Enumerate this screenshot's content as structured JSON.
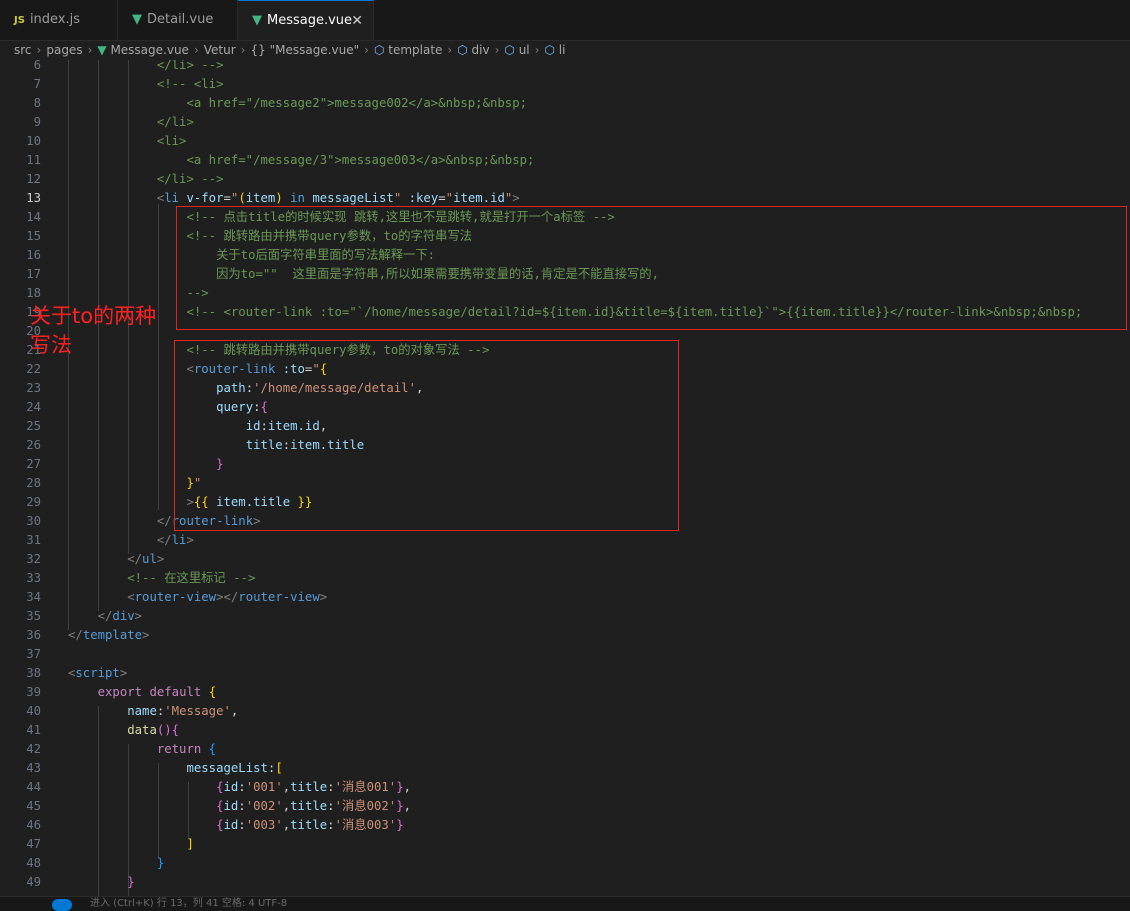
{
  "tabs": [
    {
      "label": "index.js",
      "icon": "JS"
    },
    {
      "label": "Detail.vue",
      "icon": "V"
    },
    {
      "label": "Message.vue",
      "icon": "V",
      "active": true
    }
  ],
  "breadcrumb": {
    "src": "src",
    "pages": "pages",
    "file": "Message.vue",
    "vetur": "Vetur",
    "braces": "{}",
    "module": "\"Message.vue\"",
    "template": "template",
    "div": "div",
    "ul": "ul",
    "li": "li"
  },
  "annotation": {
    "line1": "关于to的两种",
    "line2": "写法"
  },
  "statusbar": {
    "text": "进入 (Ctrl+K)   行 13，列 41   空格: 4   UTF-8"
  },
  "colors": {
    "annotation_red": "#e02424",
    "accent": "#0078d4",
    "vue_green": "#41b883"
  },
  "editor": {
    "current_line": 13,
    "lines": [
      {
        "n": 6,
        "tokens": [
          {
            "c": "t-cm",
            "v": "            </li> -->"
          }
        ]
      },
      {
        "n": 7,
        "tokens": [
          {
            "c": "t-cm",
            "v": "            <!-- <li>"
          }
        ]
      },
      {
        "n": 8,
        "tokens": [
          {
            "c": "t-cm",
            "v": "                <a href=\"/message2\">message002</a>&nbsp;&nbsp;"
          }
        ]
      },
      {
        "n": 9,
        "tokens": [
          {
            "c": "t-cm",
            "v": "            </li>"
          }
        ]
      },
      {
        "n": 10,
        "tokens": [
          {
            "c": "t-cm",
            "v": "            <li>"
          }
        ]
      },
      {
        "n": 11,
        "tokens": [
          {
            "c": "t-cm",
            "v": "                <a href=\"/message/3\">message003</a>&nbsp;&nbsp;"
          }
        ]
      },
      {
        "n": 12,
        "tokens": [
          {
            "c": "t-cm",
            "v": "            </li> -->"
          }
        ]
      },
      {
        "n": 13,
        "tokens": [
          {
            "c": "t-brk",
            "v": "            <"
          },
          {
            "c": "t-tag",
            "v": "li"
          },
          {
            "c": "t-txt",
            "v": " "
          },
          {
            "c": "t-attr",
            "v": "v-for"
          },
          {
            "c": "t-txt",
            "v": "="
          },
          {
            "c": "t-str",
            "v": "\""
          },
          {
            "c": "t-b1",
            "v": "("
          },
          {
            "c": "t-var",
            "v": "item"
          },
          {
            "c": "t-b1",
            "v": ")"
          },
          {
            "c": "t-txt",
            "v": " "
          },
          {
            "c": "t-kb",
            "v": "in"
          },
          {
            "c": "t-txt",
            "v": " "
          },
          {
            "c": "t-var",
            "v": "messageList"
          },
          {
            "c": "t-str",
            "v": "\""
          },
          {
            "c": "t-txt",
            "v": " "
          },
          {
            "c": "t-attr",
            "v": ":key"
          },
          {
            "c": "t-txt",
            "v": "="
          },
          {
            "c": "t-str",
            "v": "\""
          },
          {
            "c": "t-var",
            "v": "item.id"
          },
          {
            "c": "t-str",
            "v": "\""
          },
          {
            "c": "t-brk",
            "v": ">"
          }
        ]
      },
      {
        "n": 14,
        "tokens": [
          {
            "c": "t-cm",
            "v": "                <!-- 点击title的时候实现 跳转,这里也不是跳转,就是打开一个a标签 -->"
          }
        ]
      },
      {
        "n": 15,
        "tokens": [
          {
            "c": "t-cm",
            "v": "                <!-- 跳转路由并携带query参数，to的字符串写法"
          }
        ]
      },
      {
        "n": 16,
        "tokens": [
          {
            "c": "t-cm",
            "v": "                    关于to后面字符串里面的写法解释一下:"
          }
        ]
      },
      {
        "n": 17,
        "tokens": [
          {
            "c": "t-cm",
            "v": "                    因为to=\"\"  这里面是字符串,所以如果需要携带变量的话,肯定是不能直接写的,"
          }
        ]
      },
      {
        "n": 18,
        "tokens": [
          {
            "c": "t-cm",
            "v": "                -->"
          }
        ]
      },
      {
        "n": 19,
        "tokens": [
          {
            "c": "t-cm",
            "v": "                <!-- <router-link :to=\"`/home/message/detail?id=${item.id}&title=${item.title}`\">{{item.title}}</router-link>&nbsp;&nbsp;"
          }
        ]
      },
      {
        "n": 20,
        "tokens": []
      },
      {
        "n": 21,
        "tokens": [
          {
            "c": "t-cm",
            "v": "                <!-- 跳转路由并携带query参数，to的对象写法 -->"
          }
        ]
      },
      {
        "n": 22,
        "tokens": [
          {
            "c": "t-brk",
            "v": "                <"
          },
          {
            "c": "t-tag",
            "v": "router-link"
          },
          {
            "c": "t-txt",
            "v": " "
          },
          {
            "c": "t-attr",
            "v": ":to"
          },
          {
            "c": "t-txt",
            "v": "="
          },
          {
            "c": "t-str",
            "v": "\""
          },
          {
            "c": "t-b1",
            "v": "{"
          }
        ]
      },
      {
        "n": 23,
        "tokens": [
          {
            "c": "t-txt",
            "v": "                    "
          },
          {
            "c": "t-var",
            "v": "path"
          },
          {
            "c": "t-txt",
            "v": ":"
          },
          {
            "c": "t-str",
            "v": "'/home/message/detail'"
          },
          {
            "c": "t-txt",
            "v": ","
          }
        ]
      },
      {
        "n": 24,
        "tokens": [
          {
            "c": "t-txt",
            "v": "                    "
          },
          {
            "c": "t-var",
            "v": "query"
          },
          {
            "c": "t-txt",
            "v": ":"
          },
          {
            "c": "t-b2",
            "v": "{"
          }
        ]
      },
      {
        "n": 25,
        "tokens": [
          {
            "c": "t-txt",
            "v": "                        "
          },
          {
            "c": "t-var",
            "v": "id"
          },
          {
            "c": "t-txt",
            "v": ":"
          },
          {
            "c": "t-var",
            "v": "item.id"
          },
          {
            "c": "t-txt",
            "v": ","
          }
        ]
      },
      {
        "n": 26,
        "tokens": [
          {
            "c": "t-txt",
            "v": "                        "
          },
          {
            "c": "t-var",
            "v": "title"
          },
          {
            "c": "t-txt",
            "v": ":"
          },
          {
            "c": "t-var",
            "v": "item.title"
          }
        ]
      },
      {
        "n": 27,
        "tokens": [
          {
            "c": "t-b2",
            "v": "                    }"
          }
        ]
      },
      {
        "n": 28,
        "tokens": [
          {
            "c": "t-b1",
            "v": "                }"
          },
          {
            "c": "t-str",
            "v": "\""
          }
        ]
      },
      {
        "n": 29,
        "tokens": [
          {
            "c": "t-brk",
            "v": "                >"
          },
          {
            "c": "t-b1",
            "v": "{{"
          },
          {
            "c": "t-txt",
            "v": " "
          },
          {
            "c": "t-var",
            "v": "item.title"
          },
          {
            "c": "t-txt",
            "v": " "
          },
          {
            "c": "t-b1",
            "v": "}}"
          }
        ]
      },
      {
        "n": 30,
        "tokens": [
          {
            "c": "t-brk",
            "v": "            </"
          },
          {
            "c": "t-tag",
            "v": "router-link"
          },
          {
            "c": "t-brk",
            "v": ">"
          }
        ]
      },
      {
        "n": 31,
        "tokens": [
          {
            "c": "t-brk",
            "v": "            </"
          },
          {
            "c": "t-tag",
            "v": "li"
          },
          {
            "c": "t-brk",
            "v": ">"
          }
        ]
      },
      {
        "n": 32,
        "tokens": [
          {
            "c": "t-brk",
            "v": "        </"
          },
          {
            "c": "t-tag",
            "v": "ul"
          },
          {
            "c": "t-brk",
            "v": ">"
          }
        ]
      },
      {
        "n": 33,
        "tokens": [
          {
            "c": "t-cm",
            "v": "        <!-- 在这里标记 -->"
          }
        ]
      },
      {
        "n": 34,
        "tokens": [
          {
            "c": "t-brk",
            "v": "        <"
          },
          {
            "c": "t-tag",
            "v": "router-view"
          },
          {
            "c": "t-brk",
            "v": "></"
          },
          {
            "c": "t-tag",
            "v": "router-view"
          },
          {
            "c": "t-brk",
            "v": ">"
          }
        ]
      },
      {
        "n": 35,
        "tokens": [
          {
            "c": "t-brk",
            "v": "    </"
          },
          {
            "c": "t-tag",
            "v": "div"
          },
          {
            "c": "t-brk",
            "v": ">"
          }
        ]
      },
      {
        "n": 36,
        "tokens": [
          {
            "c": "t-brk",
            "v": "</"
          },
          {
            "c": "t-tag",
            "v": "template"
          },
          {
            "c": "t-brk",
            "v": ">"
          }
        ]
      },
      {
        "n": 37,
        "tokens": []
      },
      {
        "n": 38,
        "tokens": [
          {
            "c": "t-brk",
            "v": "<"
          },
          {
            "c": "t-tag",
            "v": "script"
          },
          {
            "c": "t-brk",
            "v": ">"
          }
        ]
      },
      {
        "n": 39,
        "tokens": [
          {
            "c": "t-kw",
            "v": "    export"
          },
          {
            "c": "t-txt",
            "v": " "
          },
          {
            "c": "t-kw",
            "v": "default"
          },
          {
            "c": "t-txt",
            "v": " "
          },
          {
            "c": "t-b1",
            "v": "{"
          }
        ]
      },
      {
        "n": 40,
        "tokens": [
          {
            "c": "t-txt",
            "v": "        "
          },
          {
            "c": "t-var",
            "v": "name"
          },
          {
            "c": "t-txt",
            "v": ":"
          },
          {
            "c": "t-str",
            "v": "'Message'"
          },
          {
            "c": "t-txt",
            "v": ","
          }
        ]
      },
      {
        "n": 41,
        "tokens": [
          {
            "c": "t-txt",
            "v": "        "
          },
          {
            "c": "t-fn",
            "v": "data"
          },
          {
            "c": "t-b2",
            "v": "()"
          },
          {
            "c": "t-b2",
            "v": "{"
          }
        ]
      },
      {
        "n": 42,
        "tokens": [
          {
            "c": "t-kw",
            "v": "            return"
          },
          {
            "c": "t-txt",
            "v": " "
          },
          {
            "c": "t-b3",
            "v": "{"
          }
        ]
      },
      {
        "n": 43,
        "tokens": [
          {
            "c": "t-txt",
            "v": "                "
          },
          {
            "c": "t-var",
            "v": "messageList"
          },
          {
            "c": "t-txt",
            "v": ":"
          },
          {
            "c": "t-b1",
            "v": "["
          }
        ]
      },
      {
        "n": 44,
        "tokens": [
          {
            "c": "t-b2",
            "v": "                    {"
          },
          {
            "c": "t-var",
            "v": "id"
          },
          {
            "c": "t-txt",
            "v": ":"
          },
          {
            "c": "t-str",
            "v": "'001'"
          },
          {
            "c": "t-txt",
            "v": ","
          },
          {
            "c": "t-var",
            "v": "title"
          },
          {
            "c": "t-txt",
            "v": ":"
          },
          {
            "c": "t-str",
            "v": "'消息001'"
          },
          {
            "c": "t-b2",
            "v": "}"
          },
          {
            "c": "t-txt",
            "v": ","
          }
        ]
      },
      {
        "n": 45,
        "tokens": [
          {
            "c": "t-b2",
            "v": "                    {"
          },
          {
            "c": "t-var",
            "v": "id"
          },
          {
            "c": "t-txt",
            "v": ":"
          },
          {
            "c": "t-str",
            "v": "'002'"
          },
          {
            "c": "t-txt",
            "v": ","
          },
          {
            "c": "t-var",
            "v": "title"
          },
          {
            "c": "t-txt",
            "v": ":"
          },
          {
            "c": "t-str",
            "v": "'消息002'"
          },
          {
            "c": "t-b2",
            "v": "}"
          },
          {
            "c": "t-txt",
            "v": ","
          }
        ]
      },
      {
        "n": 46,
        "tokens": [
          {
            "c": "t-b2",
            "v": "                    {"
          },
          {
            "c": "t-var",
            "v": "id"
          },
          {
            "c": "t-txt",
            "v": ":"
          },
          {
            "c": "t-str",
            "v": "'003'"
          },
          {
            "c": "t-txt",
            "v": ","
          },
          {
            "c": "t-var",
            "v": "title"
          },
          {
            "c": "t-txt",
            "v": ":"
          },
          {
            "c": "t-str",
            "v": "'消息003'"
          },
          {
            "c": "t-b2",
            "v": "}"
          }
        ]
      },
      {
        "n": 47,
        "tokens": [
          {
            "c": "t-b1",
            "v": "                ]"
          }
        ]
      },
      {
        "n": 48,
        "tokens": [
          {
            "c": "t-b3",
            "v": "            }"
          }
        ]
      },
      {
        "n": 49,
        "tokens": [
          {
            "c": "t-b2",
            "v": "        }"
          }
        ]
      }
    ]
  }
}
